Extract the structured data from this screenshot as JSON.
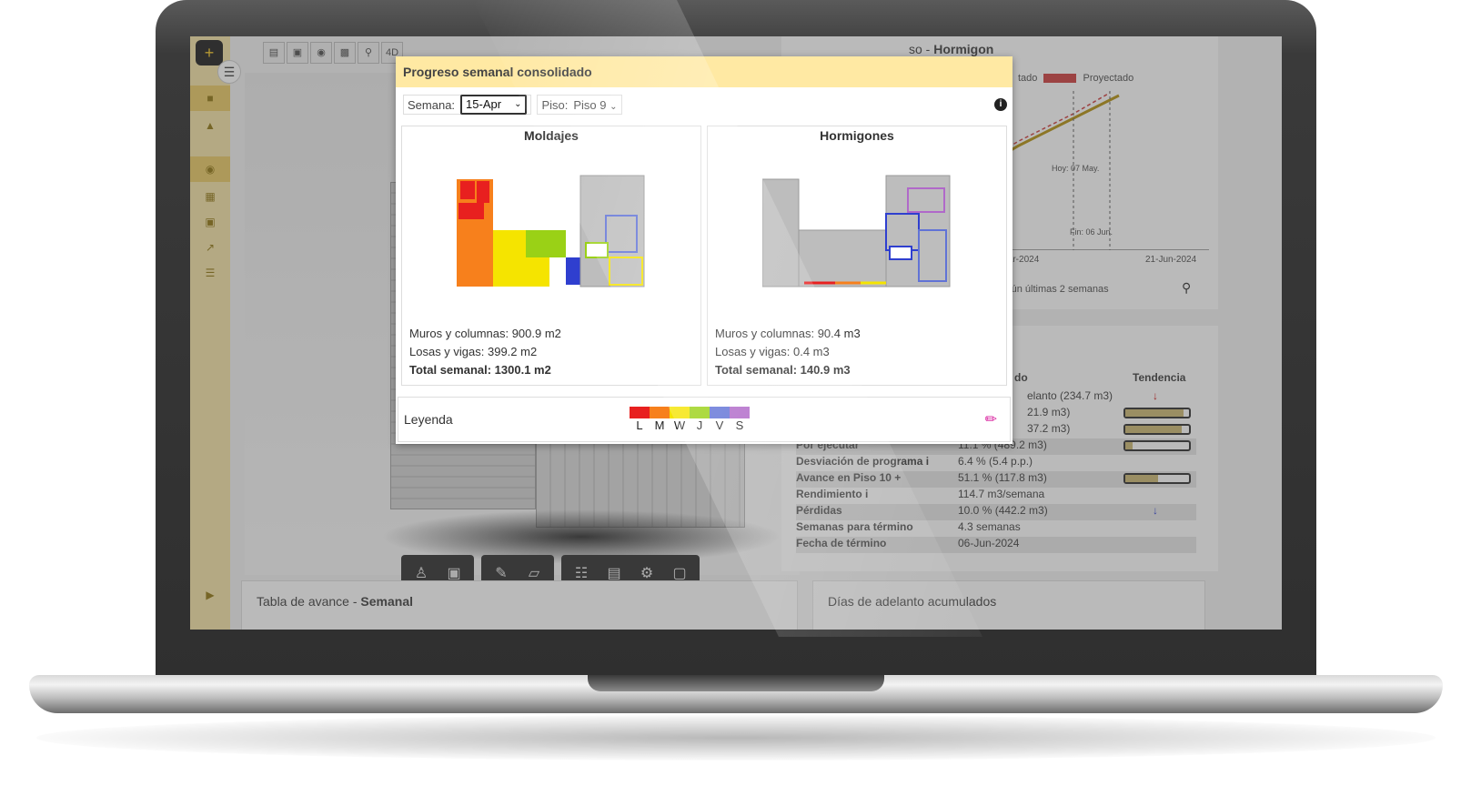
{
  "app": {
    "logo": "+",
    "chart_panel_title_prefix": "so -",
    "chart_panel_title_bold": "Hormigon",
    "chart_legend_left": "tado",
    "chart_legend_right": "Proyectado",
    "chart_annotation_today": "Hoy: 07 May.",
    "chart_annotation_end": "Fin: 06 Jun.",
    "chart_x_ticks": [
      "09-Mar-2024",
      "21-Jun-2024"
    ],
    "chart_footer": "ección según últimas 2 semanas",
    "bottom_left_title_prefix": "Tabla de avance -",
    "bottom_left_title_bold": "Semanal",
    "bottom_right_title": "Días de adelanto acumulados",
    "toolbar_4d": "4D"
  },
  "stats": {
    "header_left": "do",
    "header_right": "Tendencia",
    "rows": [
      {
        "key": "",
        "value": "elanto (234.7 m3)"
      },
      {
        "key": "",
        "value": "21.9 m3)"
      },
      {
        "key": "",
        "value": "37.2 m3)"
      },
      {
        "key": "Por ejecutar",
        "value": "11.1 % (489.2 m3)"
      },
      {
        "key": "Desviación de programa i",
        "value": "6.4 % (5.4 p.p.)"
      },
      {
        "key": "Avance en Piso 10 +",
        "value": "51.1 % (117.8 m3)"
      },
      {
        "key": "Rendimiento i",
        "value": "114.7 m3/semana"
      },
      {
        "key": "Pérdidas",
        "value": "10.0 % (442.2 m3)"
      },
      {
        "key": "Semanas para término",
        "value": "4.3 semanas"
      },
      {
        "key": "Fecha de término",
        "value": "06-Jun-2024"
      }
    ]
  },
  "modal": {
    "title": "Progreso semanal consolidado",
    "week_label": "Semana:",
    "week_value": "15-Apr",
    "floor_label": "Piso:",
    "floor_value": "Piso 9",
    "info_icon": "i",
    "moldajes": {
      "title": "Moldajes",
      "line1": "Muros y columnas: 900.9 m2",
      "line2": "Losas y vigas: 399.2 m2",
      "total": "Total semanal: 1300.1 m2"
    },
    "hormigones": {
      "title": "Hormigones",
      "line1": "Muros y columnas: 90.4 m3",
      "line2": "Losas y vigas: 0.4 m3",
      "total": "Total semanal: 140.9 m3"
    },
    "legend": {
      "title": "Leyenda",
      "days": [
        "L",
        "M",
        "W",
        "J",
        "V",
        "S"
      ],
      "colors": [
        "#e8201f",
        "#f7801c",
        "#f5e400",
        "#9ad116",
        "#6173d6",
        "#b069c9"
      ]
    }
  }
}
